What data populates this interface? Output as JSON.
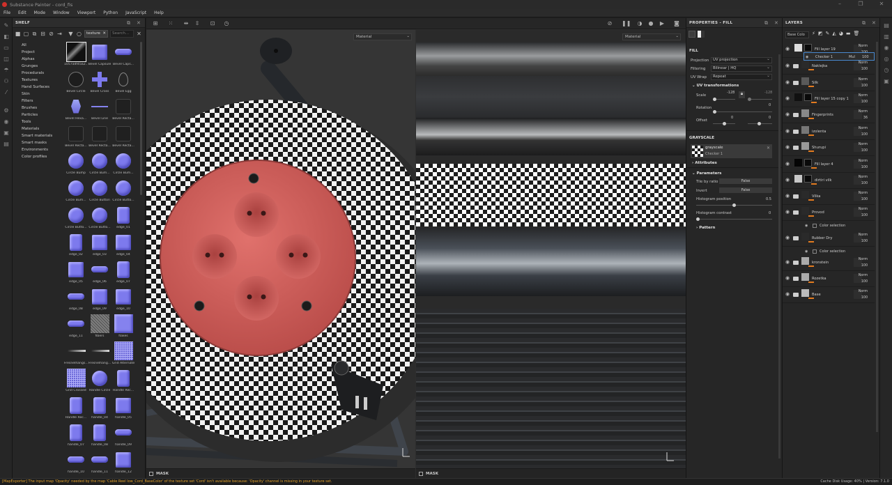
{
  "app": {
    "title": "Substance Painter - cord_fis"
  },
  "menu": [
    "File",
    "Edit",
    "Mode",
    "Window",
    "Viewport",
    "Python",
    "JavaScript",
    "Help"
  ],
  "shelf": {
    "title": "SHELF",
    "filter_text": "texture",
    "search_placeholder": "Search...",
    "categories": [
      "All",
      "Project",
      "Alphas",
      "Grunges",
      "Procedurals",
      "Textures",
      "Hand Surfaces",
      "Skin",
      "Filters",
      "Brushes",
      "Particles",
      "Tools",
      "Materials",
      "Smart materials",
      "Smart masks",
      "Environments",
      "Color profiles"
    ],
    "resources": [
      {
        "label": "1057a4f45a2...",
        "shape": "dark-streak"
      },
      {
        "label": "Bevel Capsule",
        "shape": "sq"
      },
      {
        "label": "Bevel Caps...",
        "shape": "pill"
      },
      {
        "label": "Bevel Circle",
        "shape": "outline-circle"
      },
      {
        "label": "Bevel Cross",
        "shape": "cross"
      },
      {
        "label": "Bevel Egg",
        "shape": "egg"
      },
      {
        "label": "Bevel Hexa...",
        "shape": "hex"
      },
      {
        "label": "Bevel Line",
        "shape": "line"
      },
      {
        "label": "Bevel Recta...",
        "shape": "dark"
      },
      {
        "label": "Bevel Recta...",
        "shape": "dark"
      },
      {
        "label": "Bevel Recta...",
        "shape": "dark"
      },
      {
        "label": "Bevel Recta...",
        "shape": "dark"
      },
      {
        "label": "Circle Bump",
        "shape": "circle"
      },
      {
        "label": "Circle Bum...",
        "shape": "circle"
      },
      {
        "label": "Circle Bum...",
        "shape": "circle"
      },
      {
        "label": "Circle Bum...",
        "shape": "circle"
      },
      {
        "label": "Circle Button",
        "shape": "circle"
      },
      {
        "label": "Circle Butto...",
        "shape": "circle"
      },
      {
        "label": "Circle Butto...",
        "shape": "circle"
      },
      {
        "label": "Circle Butto...",
        "shape": "circle"
      },
      {
        "label": "edge_01",
        "shape": "rect"
      },
      {
        "label": "edge_02",
        "shape": "rect"
      },
      {
        "label": "edge_03",
        "shape": "sq"
      },
      {
        "label": "edge_04",
        "shape": "sq"
      },
      {
        "label": "edge_05",
        "shape": "sq"
      },
      {
        "label": "edge_06",
        "shape": "pill"
      },
      {
        "label": "edge_07",
        "shape": "rect"
      },
      {
        "label": "edge_08",
        "shape": "pill"
      },
      {
        "label": "edge_09",
        "shape": "sq"
      },
      {
        "label": "edge_10",
        "shape": "sq"
      },
      {
        "label": "edge_11",
        "shape": "pill"
      },
      {
        "label": "fibers",
        "shape": "noise"
      },
      {
        "label": "flakes",
        "shape": "nrm"
      },
      {
        "label": "Fresnelhangs...",
        "shape": "gradline"
      },
      {
        "label": "Fresnelhang...",
        "shape": "gradline"
      },
      {
        "label": "Grid Alternate",
        "shape": "grid"
      },
      {
        "label": "Grid Crossed",
        "shape": "grid"
      },
      {
        "label": "Handle Circle",
        "shape": "circle"
      },
      {
        "label": "Handle Rec...",
        "shape": "rect"
      },
      {
        "label": "Handle Rec...",
        "shape": "rect"
      },
      {
        "label": "handle_04",
        "shape": "rect"
      },
      {
        "label": "handle_05",
        "shape": "sq"
      },
      {
        "label": "handle_07",
        "shape": "rect"
      },
      {
        "label": "handle_08",
        "shape": "rect"
      },
      {
        "label": "handle_09",
        "shape": "pill"
      },
      {
        "label": "handle_10",
        "shape": "pill"
      },
      {
        "label": "handle_11",
        "shape": "pill"
      },
      {
        "label": "handle_12",
        "shape": "sq"
      }
    ]
  },
  "viewport": {
    "left_select": "Material",
    "right_select": "Material",
    "mask_label_left": "MASK",
    "mask_label_right": "MASK"
  },
  "properties": {
    "title": "PROPERTIES - FILL",
    "fill_heading": "FILL",
    "projection_label": "Projection",
    "projection_value": "UV projection",
    "filtering_label": "Filtering",
    "filtering_value": "Bilinear | HQ",
    "uvwrap_label": "UV Wrap",
    "uvwrap_value": "Repeat",
    "uv_transform_heading": "UV transformations",
    "scale_label": "Scale",
    "scale_value_a": "-128",
    "scale_value_b": "-128",
    "rotation_label": "Rotation",
    "rotation_value": "0",
    "offset_label": "Offset",
    "offset_value_a": "0",
    "offset_value_b": "0",
    "grayscale_heading": "GRAYSCALE",
    "grayscale_name": "grayscale",
    "grayscale_resource": "Checker 1",
    "attributes_label": "Attributes",
    "parameters_label": "Parameters",
    "tile_by_ratio_label": "Tile by ratio",
    "tile_by_ratio_value": "False",
    "invert_label": "Invert",
    "invert_value": "False",
    "histogram_position_label": "Histogram position",
    "histogram_position_value": "0.5",
    "histogram_contrast_label": "Histogram contrast",
    "histogram_contrast_value": "0",
    "pattern_label": "Pattern"
  },
  "layers_panel": {
    "title": "LAYERS",
    "channel_select": "Base Colo",
    "layers": [
      {
        "name": "Fill layer 19",
        "blend": "Norm",
        "opacity": "100",
        "type": "fill"
      },
      {
        "name": "Naklejka",
        "blend": "Norm",
        "opacity": "100",
        "type": "folder"
      },
      {
        "name": "Silk",
        "blend": "Norm",
        "opacity": "100",
        "type": "folder"
      },
      {
        "name": "Fill layer 15 copy 1",
        "blend": "Norm",
        "opacity": "100",
        "type": "fill"
      },
      {
        "name": "Fingerprints",
        "blend": "Norm",
        "opacity": "36",
        "type": "folder"
      },
      {
        "name": "izolenta",
        "blend": "Norm",
        "opacity": "100",
        "type": "folder"
      },
      {
        "name": "Shurupi",
        "blend": "Norm",
        "opacity": "100",
        "type": "folder"
      },
      {
        "name": "Fill layer 4",
        "blend": "Norm",
        "opacity": "100",
        "type": "fill"
      },
      {
        "name": "dirtiri vilk",
        "blend": "Norm",
        "opacity": "100",
        "type": "fill"
      },
      {
        "name": "Vilka",
        "blend": "Norm",
        "opacity": "100",
        "type": "folder"
      },
      {
        "name": "Provod",
        "blend": "Norm",
        "opacity": "100",
        "type": "folder"
      },
      {
        "name": "Rubber Dry",
        "blend": "Norm",
        "opacity": "100",
        "type": "folder"
      },
      {
        "name": "kronstein",
        "blend": "Norm",
        "opacity": "100",
        "type": "folder"
      },
      {
        "name": "Rozetka",
        "blend": "Norm",
        "opacity": "100",
        "type": "folder"
      },
      {
        "name": "Base",
        "blend": "Norm",
        "opacity": "100",
        "type": "folder"
      }
    ],
    "effect_checker": {
      "name": "Checker 1",
      "blend": "Mul",
      "opacity": "100"
    },
    "effect_color_selection_1": "Color selection",
    "effect_color_selection_2": "Color selection"
  },
  "status": {
    "message": "[MapExporter] The input map 'Opacity' needed by the map 'Cable Reel low_Cord_BaseColor' of the texture set 'Cord' isn't available because: 'Opacity' channel is missing in your texture set.",
    "right": "Cache Disk Usage:   40% | Version: 7.1.0"
  },
  "colors": {
    "accent_orange": "#e37b1f",
    "socket_red": "#d9625f",
    "status_warning": "#e2a22c"
  },
  "icons": [
    "paint-brush-icon",
    "eraser-icon",
    "projection-icon",
    "smudge-icon",
    "clone-icon",
    "picker-icon",
    "folder-icon",
    "filter-icon",
    "eye-icon",
    "lock-icon",
    "camera-icon"
  ]
}
